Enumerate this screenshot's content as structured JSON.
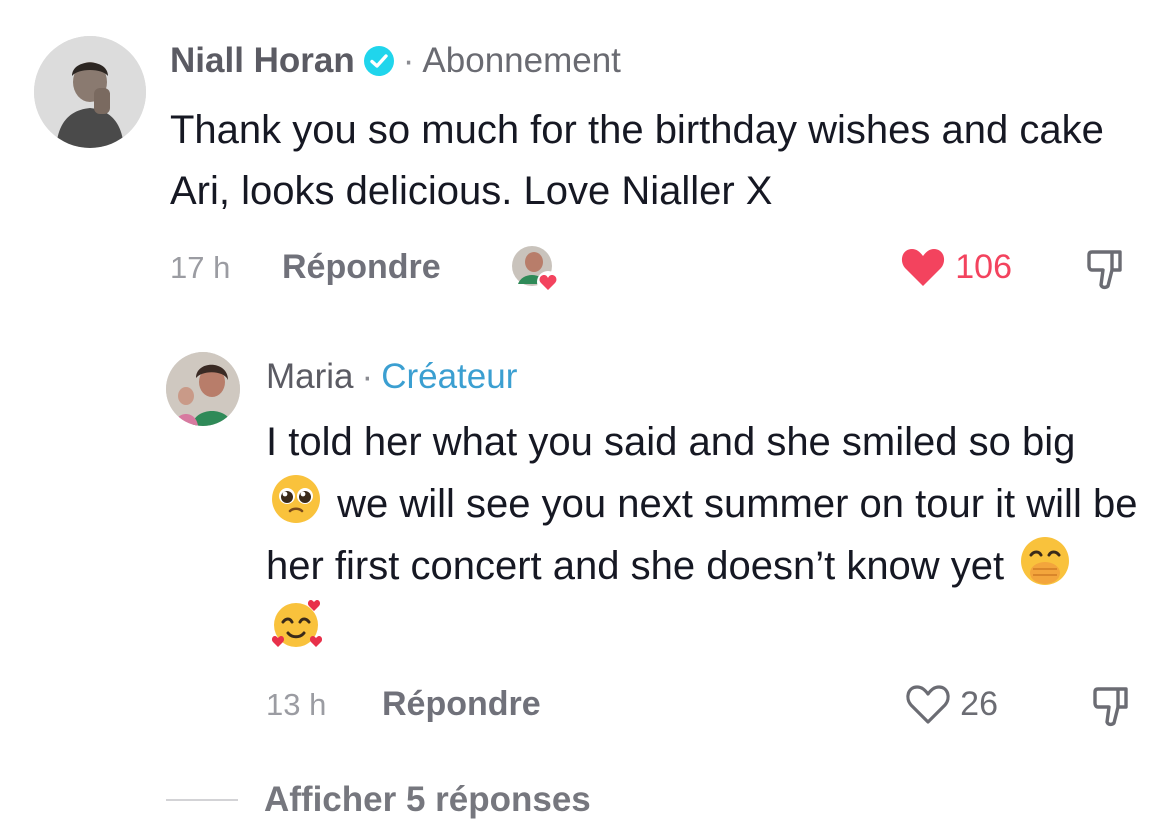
{
  "comment1": {
    "username": "Niall Horan",
    "separator": "·",
    "follow_label": "Abonnement",
    "text": "Thank you so much for the birthday wishes and cake Ari, looks delicious. Love Nialler X",
    "time": "17 h",
    "reply_label": "Répondre",
    "like_count": "106"
  },
  "comment2": {
    "username": "Maria",
    "separator": "·",
    "badge": "Créateur",
    "text_part1": "I told her what you said and she smiled so big",
    "text_part2": "we will see you next summer on tour it will be her first concert and she doesn’t know yet",
    "time": "13 h",
    "reply_label": "Répondre",
    "like_count": "26"
  },
  "view_more_label": "Afficher 5 réponses",
  "colors": {
    "like_red": "#f3435e",
    "creator_blue": "#3b9fd1",
    "verified_blue": "#20d5ec"
  }
}
